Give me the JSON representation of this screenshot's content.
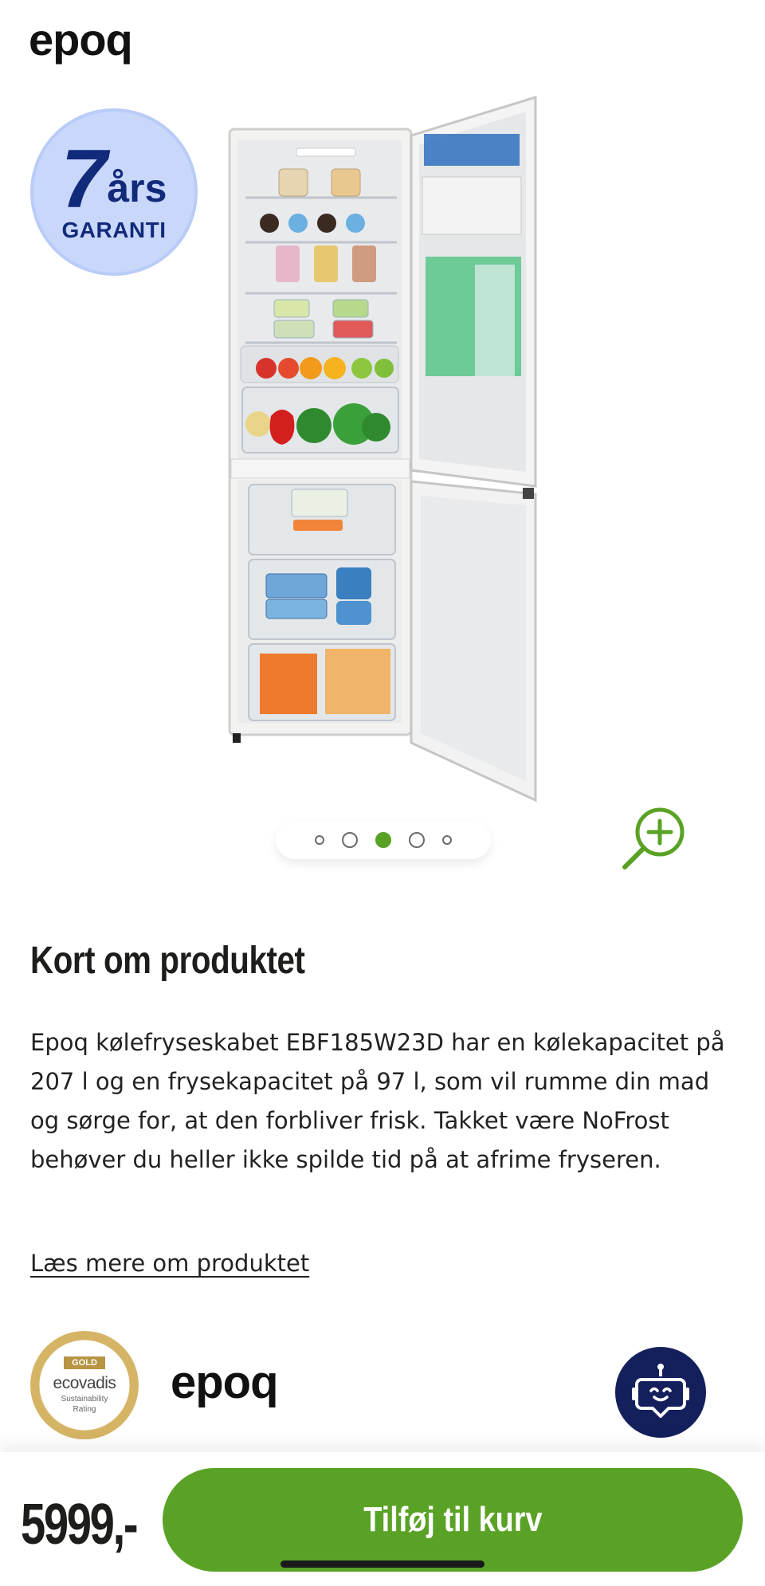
{
  "header": {
    "logo_text": "epoq"
  },
  "warranty_badge": {
    "number": "7",
    "word": "års",
    "sub": "GARANTI",
    "color": "#c9d7fb"
  },
  "gallery": {
    "image_icon": "fridge-freezer-product-image",
    "dot_count": 5,
    "active_index": 2,
    "zoom_icon": "zoom-in-icon",
    "accent": "#5aa226"
  },
  "product": {
    "heading": "Kort om produktet",
    "description": "Epoq kølefryseskabet EBF185W23D har en kølekapacitet på 207 l og en frysekapacitet på 97 l, som vil rumme din mad og sørge for, at den forbliver frisk. Takket være NoFrost behøver du heller ikke spilde tid på at afrime fryseren.",
    "read_more": "Læs mere om produktet"
  },
  "footer_logos": {
    "ecovadis": {
      "ribbon": "GOLD",
      "brand": "ecovadis",
      "line1": "Sustainability",
      "line2": "Rating"
    },
    "logo_text": "epoq"
  },
  "chat": {
    "icon": "chatbot-icon",
    "color": "#14205c"
  },
  "bottom_bar": {
    "price": "5999,-",
    "cart_label": "Tilføj til kurv",
    "button_color": "#5aa226"
  }
}
